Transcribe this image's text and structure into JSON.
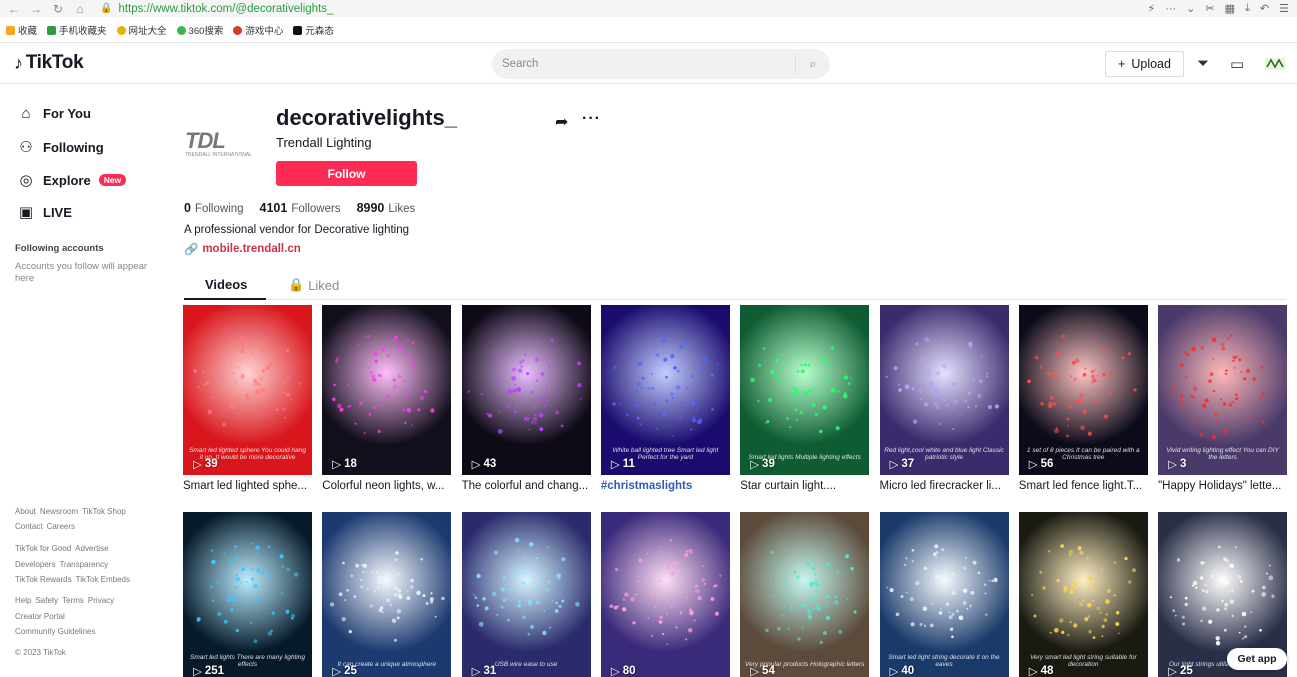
{
  "browser": {
    "url": "https://www.tiktok.com/@decorativelights_",
    "bookmarks": [
      "收藏",
      "手机收藏夹",
      "网址大全",
      "360搜索",
      "游戏中心",
      "元森态"
    ]
  },
  "header": {
    "logo_text": "TikTok",
    "search_placeholder": "Search",
    "upload_label": "Upload"
  },
  "sidebar": {
    "items": [
      {
        "label": "For You",
        "icon": "home-icon"
      },
      {
        "label": "Following",
        "icon": "users-icon"
      },
      {
        "label": "Explore",
        "icon": "compass-icon",
        "badge": "New"
      },
      {
        "label": "LIVE",
        "icon": "live-icon"
      }
    ],
    "following_title": "Following accounts",
    "following_sub": "Accounts you follow will appear here",
    "footer": [
      [
        "About",
        "Newsroom",
        "TikTok Shop"
      ],
      [
        "Contact",
        "Careers"
      ],
      [
        "TikTok for Good",
        "Advertise"
      ],
      [
        "Developers",
        "Transparency"
      ],
      [
        "TikTok Rewards",
        "TikTok Embeds"
      ],
      [
        "Help",
        "Safety",
        "Terms",
        "Privacy"
      ],
      [
        "Creator Portal"
      ],
      [
        "Community Guidelines"
      ],
      [
        "© 2023 TikTok"
      ]
    ]
  },
  "profile": {
    "avatar_mark": "TDL",
    "avatar_tag": "TRENDALL INTERNATIONAL",
    "username": "decorativelights_",
    "nickname": "Trendall Lighting",
    "follow_label": "Follow",
    "stats": [
      {
        "num": "0",
        "label": "Following"
      },
      {
        "num": "4101",
        "label": "Followers"
      },
      {
        "num": "8990",
        "label": "Likes"
      }
    ],
    "bio": "A professional vendor for Decorative lighting",
    "link": "mobile.trendall.cn"
  },
  "tabs": {
    "videos": "Videos",
    "liked": "Liked"
  },
  "videos": [
    {
      "views": "39",
      "title": "Smart led lighted sphe...",
      "bg": "#d8161c",
      "accent": "#ff7b7b",
      "caption": "Smart led lighted sphere You could hang it up. It would be more decorative"
    },
    {
      "views": "18",
      "title": "Colorful neon lights, w...",
      "bg": "#120f1c",
      "accent": "#ff3df0",
      "caption": ""
    },
    {
      "views": "43",
      "title": "The colorful and chang...",
      "bg": "#0e0a16",
      "accent": "#c040ff",
      "caption": ""
    },
    {
      "views": "11",
      "title": "#christmaslights",
      "bg": "#1a0c6e",
      "accent": "#4d6bff",
      "caption": "White ball lighted tree Smart led light Perfect for the yard",
      "is_tag": true
    },
    {
      "views": "39",
      "title": "Star curtain light....",
      "bg": "#0f5b32",
      "accent": "#27ff6a",
      "caption": "Smart led lights Multiple lighting effects"
    },
    {
      "views": "37",
      "title": "Micro led firecracker li...",
      "bg": "#3b2a6c",
      "accent": "#b2a2ff",
      "caption": "Red light,cool white and blue light Classic patriotic style"
    },
    {
      "views": "56",
      "title": "Smart led fence light.T...",
      "bg": "#0b0b1a",
      "accent": "#ff4d4d",
      "caption": "1 set of 8 pieces It can be paired with a Christmas tree"
    },
    {
      "views": "3",
      "title": "\"Happy Holidays\" lette...",
      "bg": "#4a3a6a",
      "accent": "#ff2a2a",
      "caption": "Vivid writing lighting effect You can DIY the letters"
    },
    {
      "views": "251",
      "title": "",
      "bg": "#061a2a",
      "accent": "#35c8ff",
      "caption": "Smart led lights There are many lighting effects"
    },
    {
      "views": "25",
      "title": "",
      "bg": "#1c3a70",
      "accent": "#e8f0ff",
      "caption": "It can create a unique atmosphere"
    },
    {
      "views": "31",
      "title": "",
      "bg": "#2a2a6c",
      "accent": "#7fe0ff",
      "caption": "USB wire ease to use"
    },
    {
      "views": "80",
      "title": "",
      "bg": "#3a2a7a",
      "accent": "#ff9ae0",
      "caption": ""
    },
    {
      "views": "54",
      "title": "",
      "bg": "#5c4a3a",
      "accent": "#4de8d0",
      "caption": "Very popular products Holographic letters"
    },
    {
      "views": "40",
      "title": "",
      "bg": "#1a3a6a",
      "accent": "#e8f4ff",
      "caption": "Smart led light string decorate it on the eaves"
    },
    {
      "views": "48",
      "title": "",
      "bg": "#1a1a12",
      "accent": "#ffd24d",
      "caption": "Very smart led light string suitable for decoration"
    },
    {
      "views": "25",
      "title": "",
      "bg": "#2a2f48",
      "accent": "#ffffff",
      "caption": "Our light strings utilize crackle design"
    }
  ],
  "get_app": "Get app",
  "colors": {
    "accent": "#fe2c55",
    "link": "#c8344a"
  }
}
